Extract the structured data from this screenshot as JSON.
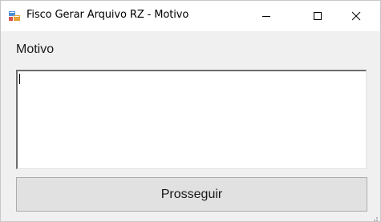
{
  "window": {
    "title": "Fisco Gerar Arquivo RZ - Motivo",
    "app_icon": "windows-form-icon",
    "controls": {
      "minimize_icon": "minimize-icon",
      "maximize_icon": "maximize-icon",
      "close_icon": "close-icon"
    }
  },
  "form": {
    "motivo_label": "Motivo",
    "motivo_value": "",
    "submit_label": "Prosseguir"
  },
  "colors": {
    "client_background": "#f0f0f0",
    "titlebar_background": "#ffffff",
    "button_background": "#e1e1e1",
    "button_border": "#adadad"
  }
}
